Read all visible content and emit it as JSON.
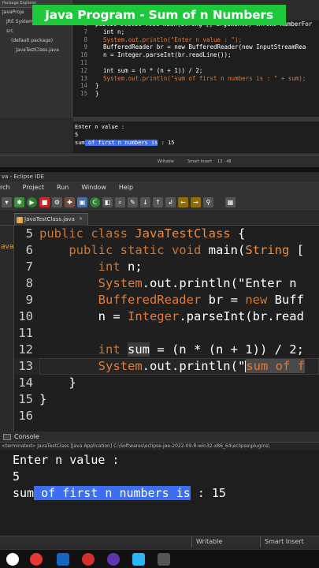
{
  "banner": {
    "title": "Java Program - Sum of n Numbers"
  },
  "top_screen": {
    "explorer": {
      "tab_label": "Package Explorer",
      "items": [
        {
          "label": "JavaProje"
        },
        {
          "label": "JRE System Library [Java"
        },
        {
          "label": "src"
        },
        {
          "label": "(default package)"
        },
        {
          "label": "JavaTestClass.java"
        }
      ]
    },
    "code_lines": [
      {
        "num": "6",
        "text": "public static void main(String [] arguments) throws NumberFor"
      },
      {
        "num": "7",
        "text": "int n;"
      },
      {
        "num": "8",
        "text": "System.out.println(\"Enter n value : \");"
      },
      {
        "num": "9",
        "text": "BufferedReader br = new BufferedReader(new InputStreamRea"
      },
      {
        "num": "10",
        "text": "n = Integer.parseInt(br.readLine());"
      },
      {
        "num": "11",
        "text": ""
      },
      {
        "num": "12",
        "text": "int sum = (n * (n + 1)) / 2;"
      },
      {
        "num": "13",
        "text": "System.out.println(\"sum of first n numbers is : \" + sum);"
      },
      {
        "num": "14",
        "text": "}"
      },
      {
        "num": "15",
        "text": "}"
      }
    ],
    "console": {
      "line1": "Enter n value :",
      "line2": "5",
      "line3_prefix": "sum",
      "line3_sel": " of first n numbers is",
      "line3_suffix": " : 15"
    },
    "bottom_status": {
      "writable": "Writable",
      "insert": "Smart Insert",
      "position": "13 : 48"
    }
  },
  "ide": {
    "title": "va - Eclipse IDE",
    "menu": [
      "rch",
      "Project",
      "Run",
      "Window",
      "Help"
    ],
    "file_tab": {
      "label": "JavaTestClass.java"
    },
    "gutter_label": "ava",
    "code_lines": [
      {
        "num": "5",
        "text": "public class JavaTestClass {"
      },
      {
        "num": "6",
        "text": "    public static void main(String ["
      },
      {
        "num": "7",
        "text": "        int n;"
      },
      {
        "num": "8",
        "text": "        System.out.println(\"Enter n "
      },
      {
        "num": "9",
        "text": "        BufferedReader br = new Buff"
      },
      {
        "num": "10",
        "text": "        n = Integer.parseInt(br.read"
      },
      {
        "num": "11",
        "text": ""
      },
      {
        "num": "12",
        "text": "        int sum = (n * (n + 1)) / 2;"
      },
      {
        "num": "13",
        "text": "        System.out.println(\"sum of f"
      },
      {
        "num": "14",
        "text": "    }"
      },
      {
        "num": "15",
        "text": "}"
      },
      {
        "num": "16",
        "text": ""
      }
    ],
    "console": {
      "tab_label": "Console",
      "terminated": "<terminated> JavaTestClass [Java Application] C:\\Softwares\\eclipse-jee-2022-09-R-win32-x86_64\\eclipse\\plugins\\",
      "line1": "Enter n value :",
      "line2": "5",
      "line3_prefix": "sum",
      "line3_sel": " of first n numbers is",
      "line3_suffix": " : 15"
    },
    "status": {
      "writable": "Writable",
      "insert": "Smart Insert"
    }
  },
  "colors": {
    "banner_green": "#1dc93a",
    "keyword": "#cc7832",
    "string": "#e07b39",
    "selection": "#3d6ef2"
  }
}
